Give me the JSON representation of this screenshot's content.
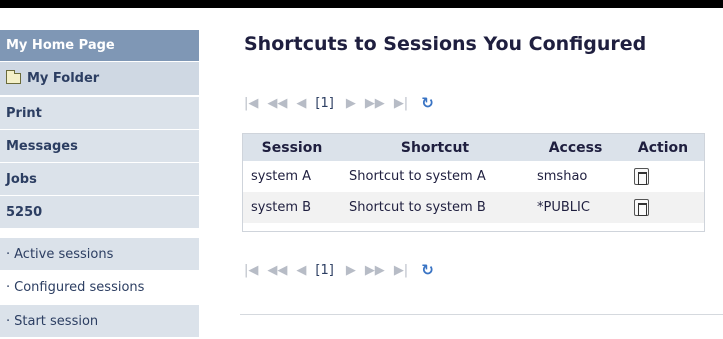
{
  "sidebar": {
    "home": "My Home Page",
    "folder": "My Folder",
    "print": "Print",
    "messages": "Messages",
    "jobs": "Jobs",
    "section_5250": "5250",
    "active_sessions": "Active sessions",
    "configured_sessions": "Configured sessions",
    "start_session": "Start session",
    "bullet": "·"
  },
  "page": {
    "title": "Shortcuts to Sessions You Configured"
  },
  "pager": {
    "first": "|◀",
    "prev_page": "◀◀",
    "prev": "◀",
    "current": "[1]",
    "next": "▶",
    "next_page": "▶▶",
    "last": "▶|",
    "refresh": "↻"
  },
  "table": {
    "headers": [
      "Session",
      "Shortcut",
      "Access",
      "Action"
    ],
    "rows": [
      [
        "system A",
        "Shortcut to system A",
        "smshao"
      ],
      [
        "system B",
        "Shortcut to system B",
        "*PUBLIC"
      ]
    ]
  },
  "colors": {
    "nav_header": "#7f97b5",
    "nav_item": "#dbe2ea",
    "text_dark": "#1f1f3f",
    "refresh": "#3a74c4"
  }
}
